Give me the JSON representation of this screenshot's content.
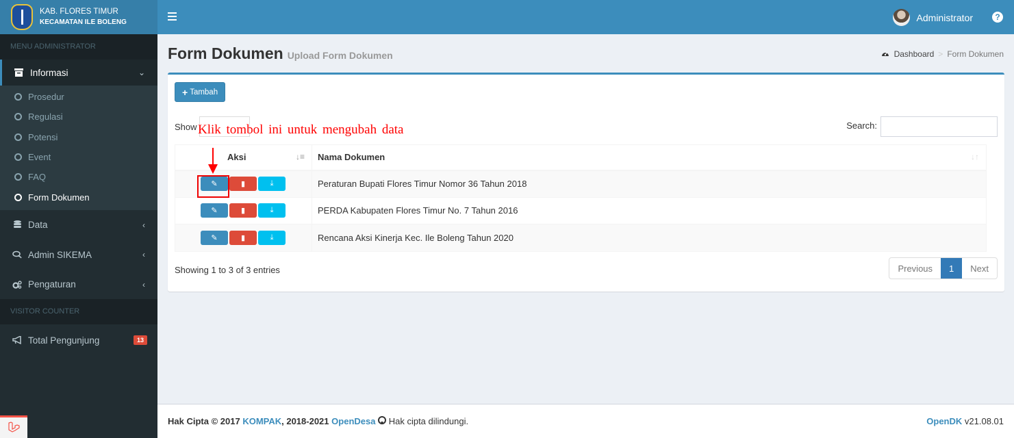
{
  "brand": {
    "line1": "KAB. FLORES TIMUR",
    "line2": "KECAMATAN ILE BOLENG"
  },
  "sidebar": {
    "header_menu": "MENU ADMINISTRATOR",
    "informasi": {
      "label": "Informasi",
      "items": [
        {
          "label": "Prosedur"
        },
        {
          "label": "Regulasi"
        },
        {
          "label": "Potensi"
        },
        {
          "label": "Event"
        },
        {
          "label": "FAQ"
        },
        {
          "label": "Form Dokumen",
          "active": true
        }
      ]
    },
    "menu": [
      {
        "label": "Data",
        "icon": "database-icon"
      },
      {
        "label": "Admin SIKEMA",
        "icon": "comments-icon"
      },
      {
        "label": "Pengaturan",
        "icon": "cogs-icon"
      }
    ],
    "header_visitor": "VISITOR COUNTER",
    "visitor": {
      "label": "Total Pengunjung",
      "count": "13"
    }
  },
  "topbar": {
    "user_name": "Administrator",
    "help": "?"
  },
  "page": {
    "title": "Form Dokumen",
    "subtitle": "Upload Form Dokumen",
    "breadcrumb": {
      "home": "Dashboard",
      "sep": ">",
      "current": "Form Dokumen"
    }
  },
  "box": {
    "add_label": "Tambah",
    "show_label": "Show",
    "search_label": "Search:",
    "search_value": "",
    "columns": [
      "Aksi",
      "Nama Dokumen"
    ],
    "rows": [
      {
        "name": "Peraturan Bupati Flores Timur Nomor 36 Tahun 2018"
      },
      {
        "name": "PERDA Kabupaten Flores Timur No. 7 Tahun 2016"
      },
      {
        "name": "Rencana Aksi Kinerja Kec. Ile Boleng Tahun 2020"
      }
    ],
    "info": "Showing 1 to 3 of 3 entries",
    "pagination": {
      "previous": "Previous",
      "page": "1",
      "next": "Next"
    }
  },
  "annotation": {
    "text": "Klik tombol ini untuk mengubah data"
  },
  "footer": {
    "prefix": "Hak Cipta © 2017",
    "kompak": "KOMPAK",
    "middle": ", 2018-2021",
    "opendesa": "OpenDesa",
    "suffix": "Hak cipta dilindungi.",
    "app": "OpenDK",
    "version": "v21.08.01"
  },
  "colors": {
    "primary": "#3c8dbc",
    "danger": "#dd4b39",
    "info": "#00c0ef",
    "sidebar": "#222d32",
    "annotation": "#ff0000"
  }
}
